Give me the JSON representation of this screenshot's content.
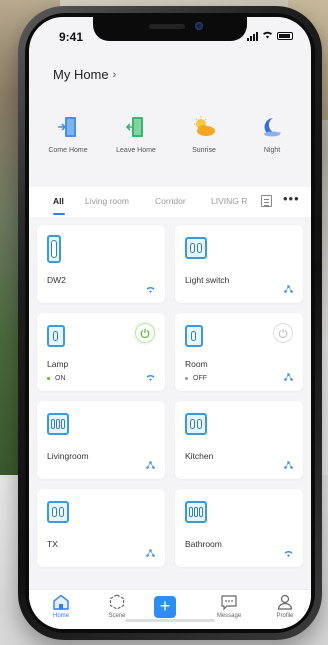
{
  "status_bar": {
    "time": "9:41"
  },
  "header": {
    "title": "My Home",
    "chevron": "›"
  },
  "scenes": [
    {
      "label": "Come Home",
      "icon": "door-enter-icon",
      "color": "#4a90e2"
    },
    {
      "label": "Leave Home",
      "icon": "door-exit-icon",
      "color": "#3cb371"
    },
    {
      "label": "Sunrise",
      "icon": "sun-cloud-icon",
      "color": "#f5a623"
    },
    {
      "label": "Night",
      "icon": "moon-icon",
      "color": "#3a6fd8"
    }
  ],
  "tabs": [
    {
      "label": "All",
      "active": true
    },
    {
      "label": "Living room"
    },
    {
      "label": "Corridor"
    },
    {
      "label": "LIVING R"
    }
  ],
  "tab_more": "•••",
  "devices": [
    {
      "name": "DW2",
      "icon": "door-sensor-icon",
      "net": "wifi-icon"
    },
    {
      "name": "Light switch",
      "icon": "switch-2gang-icon",
      "net": "mesh-icon"
    },
    {
      "name": "Lamp",
      "icon": "switch-1gang-icon",
      "state": "ON",
      "state_color": "#52c41a",
      "power": true,
      "net": "wifi-icon"
    },
    {
      "name": "Room",
      "icon": "switch-1gang-icon",
      "state": "OFF",
      "state_color": "#999999",
      "power": false,
      "net": "mesh-icon"
    },
    {
      "name": "Livingroom",
      "icon": "switch-3gang-icon",
      "net": "mesh-icon"
    },
    {
      "name": "Kitchen",
      "icon": "switch-2gang-icon",
      "net": "mesh-icon"
    },
    {
      "name": "TX",
      "icon": "switch-2gang-icon",
      "net": "mesh-icon"
    },
    {
      "name": "Bathroom",
      "icon": "switch-3gang-icon",
      "net": "wifi-icon"
    }
  ],
  "bottom_nav": [
    {
      "label": "Home",
      "icon": "home-icon",
      "active": true
    },
    {
      "label": "Scene",
      "icon": "scene-hexagon-icon"
    },
    {
      "label": "Message",
      "icon": "message-icon"
    },
    {
      "label": "Profile",
      "icon": "user-icon"
    }
  ],
  "add_button": "+",
  "colors": {
    "accent": "#2e8cf3",
    "device_icon": "#3c9bd6",
    "on": "#52c41a"
  }
}
